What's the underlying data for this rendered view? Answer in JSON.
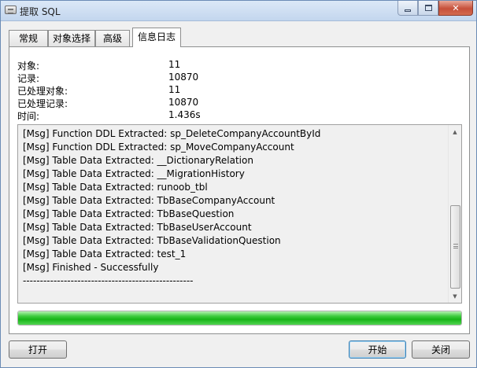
{
  "window": {
    "title": "提取 SQL",
    "icon": "database-icon"
  },
  "tabs": [
    {
      "label": "常规",
      "active": false
    },
    {
      "label": "对象选择",
      "active": false
    },
    {
      "label": "高级",
      "active": false
    },
    {
      "label": "信息日志",
      "active": true
    }
  ],
  "summary": [
    {
      "label": "对象:",
      "value": "11"
    },
    {
      "label": "记录:",
      "value": "10870"
    },
    {
      "label": "已处理对象:",
      "value": "11"
    },
    {
      "label": "已处理记录:",
      "value": "10870"
    },
    {
      "label": "时间:",
      "value": "1.436s"
    }
  ],
  "log": [
    "[Msg] Function DDL Extracted: sp_DeleteCompanyAccountById",
    "[Msg] Function DDL Extracted: sp_MoveCompanyAccount",
    "[Msg] Table Data Extracted: __DictionaryRelation",
    "[Msg] Table Data Extracted: __MigrationHistory",
    "[Msg] Table Data Extracted: runoob_tbl",
    "[Msg] Table Data Extracted: TbBaseCompanyAccount",
    "[Msg] Table Data Extracted: TbBaseQuestion",
    "[Msg] Table Data Extracted: TbBaseUserAccount",
    "[Msg] Table Data Extracted: TbBaseValidationQuestion",
    "[Msg] Table Data Extracted: test_1",
    "[Msg] Finished - Successfully",
    "--------------------------------------------------"
  ],
  "progress": {
    "percent": 100,
    "color": "#1fbf1f"
  },
  "buttons": {
    "open": "打开",
    "start": "开始",
    "close": "关闭"
  },
  "colors": {
    "titlebar": "#c3d6ee",
    "close_button": "#c6503a"
  }
}
